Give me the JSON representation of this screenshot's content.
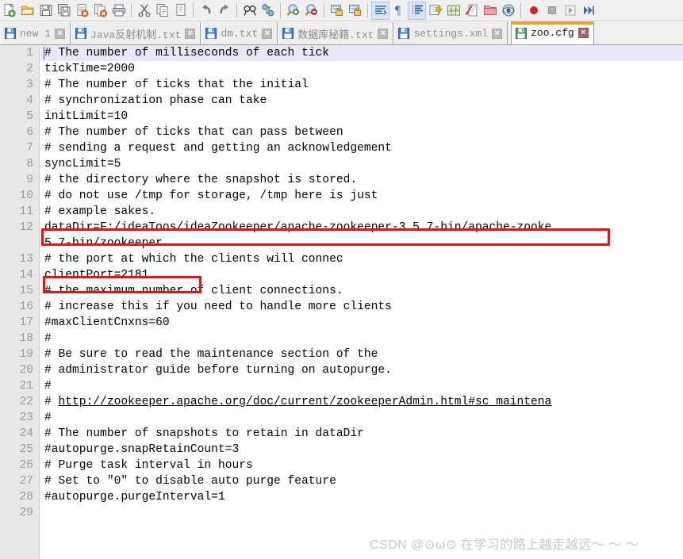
{
  "toolbar": {
    "groups": [
      {
        "items": [
          {
            "name": "new-file-icon",
            "label": "New"
          },
          {
            "name": "open-file-icon",
            "label": "Open"
          },
          {
            "name": "save-icon",
            "label": "Save"
          },
          {
            "name": "save-all-icon",
            "label": "Save All"
          },
          {
            "name": "close-file-icon",
            "label": "Close"
          },
          {
            "name": "close-all-files-icon",
            "label": "Close All"
          },
          {
            "name": "print-icon",
            "label": "Print"
          }
        ]
      },
      {
        "items": [
          {
            "name": "cut-icon",
            "label": "Cut"
          },
          {
            "name": "copy-icon",
            "label": "Copy"
          },
          {
            "name": "paste-icon",
            "label": "Paste"
          }
        ]
      },
      {
        "items": [
          {
            "name": "undo-icon",
            "label": "Undo"
          },
          {
            "name": "redo-icon",
            "label": "Redo"
          }
        ]
      },
      {
        "items": [
          {
            "name": "find-icon",
            "label": "Find"
          },
          {
            "name": "replace-icon",
            "label": "Replace"
          }
        ]
      },
      {
        "items": [
          {
            "name": "zoom-in-icon",
            "label": "Zoom In"
          },
          {
            "name": "zoom-out-icon",
            "label": "Zoom Out"
          }
        ]
      },
      {
        "items": [
          {
            "name": "sync-vertical-scroll-icon",
            "label": "Synchronize Vertical Scrolling"
          },
          {
            "name": "sync-horizontal-scroll-icon",
            "label": "Synchronize Horizontal Scrolling"
          }
        ]
      },
      {
        "items": [
          {
            "name": "word-wrap-icon",
            "label": "Word wrap",
            "active": true
          },
          {
            "name": "show-all-characters-icon",
            "label": "Show All Characters"
          },
          {
            "name": "show-indent-guide-icon",
            "label": "Show Indent Guide",
            "active": true
          },
          {
            "name": "user-defined-dialog-icon",
            "label": "User-Defined Dialogue"
          },
          {
            "name": "document-map-icon",
            "label": "Document Map"
          },
          {
            "name": "function-list-icon",
            "label": "Function List"
          },
          {
            "name": "folder-as-workspace-icon",
            "label": "Folder as Workspace"
          },
          {
            "name": "monitoring-icon",
            "label": "Monitoring"
          }
        ]
      },
      {
        "items": [
          {
            "name": "record-macro-icon",
            "label": "Start Recording"
          },
          {
            "name": "stop-macro-icon",
            "label": "Stop Recording"
          },
          {
            "name": "play-macro-icon",
            "label": "Playback"
          },
          {
            "name": "run-macro-multiple-icon",
            "label": "Run a Macro Multiple Times"
          }
        ]
      }
    ]
  },
  "tabs": [
    {
      "label": "new 1",
      "icon": "floppy-disk-icon",
      "active": false,
      "close": "×"
    },
    {
      "label": "Java反射机制.txt",
      "icon": "floppy-disk-icon",
      "active": false,
      "close": "×"
    },
    {
      "label": "dm.txt",
      "icon": "floppy-disk-icon",
      "active": false,
      "close": "×"
    },
    {
      "label": "数据库秘籍.txt",
      "icon": "floppy-disk-icon",
      "active": false,
      "close": "×"
    },
    {
      "label": "settings.xml",
      "icon": "floppy-disk-icon",
      "active": false,
      "close": "×"
    },
    {
      "label": "zoo.cfg",
      "icon": "floppy-disk-icon",
      "active": true,
      "close": "×"
    }
  ],
  "editor": {
    "filename": "zoo.cfg",
    "line_numbers": [
      1,
      2,
      3,
      4,
      5,
      6,
      7,
      8,
      9,
      10,
      11,
      12,
      13,
      14,
      15,
      16,
      17,
      18,
      19,
      20,
      21,
      22,
      23,
      24,
      25,
      26,
      27,
      28,
      29
    ],
    "lines": [
      {
        "n": 1,
        "text": "# The number of milliseconds of each tick",
        "highlighted": true
      },
      {
        "n": 2,
        "text": "tickTime=2000"
      },
      {
        "n": 3,
        "text": "# The number of ticks that the initial"
      },
      {
        "n": 4,
        "text": "# synchronization phase can take"
      },
      {
        "n": 5,
        "text": "initLimit=10"
      },
      {
        "n": 6,
        "text": "# The number of ticks that can pass between"
      },
      {
        "n": 7,
        "text": "# sending a request and getting an acknowledgement"
      },
      {
        "n": 8,
        "text": "syncLimit=5"
      },
      {
        "n": 9,
        "text": "# the directory where the snapshot is stored."
      },
      {
        "n": 10,
        "text": "# do not use /tmp for storage, /tmp here is just"
      },
      {
        "n": 11,
        "text": "# example sakes."
      },
      {
        "n": 12,
        "text": "dataDir=F:/ideaToos/ideaZookeeper/apache-zookeeper-3.5.7-bin/apache-zooke",
        "wrapped": "5.7-bin/zookeeper"
      },
      {
        "n": 13,
        "text": "# the port at which the clients will connec"
      },
      {
        "n": 14,
        "text": "clientPort=2181"
      },
      {
        "n": 15,
        "text": "# the maximum number of client connections."
      },
      {
        "n": 16,
        "text": "# increase this if you need to handle more clients"
      },
      {
        "n": 17,
        "text": "#maxClientCnxns=60"
      },
      {
        "n": 18,
        "text": "#"
      },
      {
        "n": 19,
        "text": "# Be sure to read the maintenance section of the"
      },
      {
        "n": 20,
        "text": "# administrator guide before turning on autopurge."
      },
      {
        "n": 21,
        "text": "#"
      },
      {
        "n": 22,
        "text": "# ",
        "link": "http://zookeeper.apache.org/doc/current/zookeeperAdmin.html#sc_maintena"
      },
      {
        "n": 23,
        "text": "#"
      },
      {
        "n": 24,
        "text": "# The number of snapshots to retain in dataDir"
      },
      {
        "n": 25,
        "text": "#autopurge.snapRetainCount=3"
      },
      {
        "n": 26,
        "text": "# Purge task interval in hours"
      },
      {
        "n": 27,
        "text": "# Set to \"0\" to disable auto purge feature"
      },
      {
        "n": 28,
        "text": "#autopurge.purgeInterval=1"
      },
      {
        "n": 29,
        "text": ""
      }
    ],
    "line12_text": "dataDir=F:/ideaToos/ideaZookeeper/apache-zookeeper-3.5.7-bin/apache-zooke",
    "line12_wrap": "5.7-bin/zookeeper",
    "line22_prefix": "# ",
    "line22_link": "http://zookeeper.apache.org/doc/current/zookeeperAdmin.html#sc_maintena"
  },
  "annotations": [
    {
      "name": "datadir-highlight-box",
      "color": "#ee1111",
      "target_line": 12
    },
    {
      "name": "clientport-highlight-box",
      "color": "#ee1111",
      "target_line": 14
    }
  ],
  "watermark": {
    "text": "CSDN @⊙ω⊙ 在学习的路上越走越远～ ～ ～",
    "color": "#c6c6c6"
  },
  "theme": {
    "toolbar_bg": "#f0f0f0",
    "gutter_bg": "#e7e7e7",
    "line_number_color": "#9b9b9b",
    "editor_bg": "#ffffff",
    "text_color": "#000000",
    "active_tab_accent": "#f0a030",
    "current_line_bg": "#e8e8f8",
    "annotation_red": "#ee1111"
  }
}
